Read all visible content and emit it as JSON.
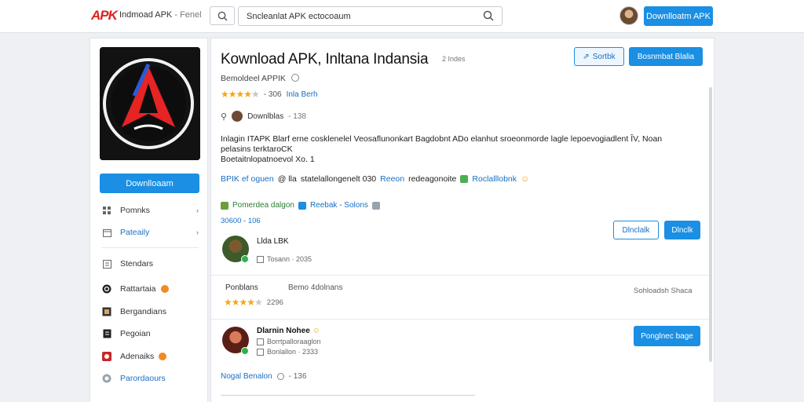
{
  "header": {
    "logo": "APK",
    "app_title": "Indmoad APK",
    "app_subtitle": "- Fenel",
    "search_value": "Sncleanlat APK ectocoaum",
    "download_label": "Downlloatm APK"
  },
  "sidebar": {
    "download_label": "Downlloaam",
    "items": [
      {
        "label": "Pomnks",
        "icon": "grid-icon"
      },
      {
        "label": "Pateaily",
        "icon": "calendar-icon"
      },
      {
        "label": "Stendars",
        "icon": "list-icon"
      },
      {
        "label": "Rattartaia",
        "icon": "at-icon"
      },
      {
        "label": "Bergandians",
        "icon": "book-icon"
      },
      {
        "label": "Pegoian",
        "icon": "doc-icon"
      },
      {
        "label": "Adenaiks",
        "icon": "red-app-icon"
      },
      {
        "label": "Parordaours",
        "icon": "circle-icon"
      }
    ]
  },
  "main": {
    "title": "Kownload APK, Inltana Indansia",
    "title_meta": "2 Indes",
    "share_label": "Sortbk",
    "report_label": "Bosnmbat Blalia",
    "developer": "Bemoldeel APPIK",
    "rating_value": "- 306",
    "rating_link": "Inla Berh",
    "downloads_label": "Downlblas",
    "downloads_meta": "- 138",
    "description_line1": "Inlagin ITAPK Blarf erne cosklenelel Veosaflunonkart Bagdobnt ADo elanhut sroeonmorde lagle lepoevogiadlent ÎV, Noan",
    "description_line2": "pelasins terktaroCK",
    "description_line3": "Boetaitnlopatnoevol Xo. 1",
    "tags": {
      "t1": "BPIK ef oguen",
      "t2": "@ lla",
      "t3": "statelallongenelt 030",
      "t4": "Reeon",
      "t5": "redeagonoite",
      "t6": "Roclalllobnk"
    },
    "features": {
      "f1": "Pomerdea dalgon",
      "f2": "Reebak - Solons"
    },
    "count": "30600 - 106",
    "user1": {
      "name": "Llda LBK",
      "meta": "Tosann · 2035"
    },
    "btn_outline1": "Dlnclalk",
    "btn_solid1": "Dlnclk",
    "reviews": {
      "label_left": "Ponblans",
      "label_mid": "Bemo 4dolnans",
      "label_right": "Sohloadsh Shaca",
      "score": "2296"
    },
    "user2": {
      "name": "Dlarnin Nohee",
      "meta1": "Borrtpalloraaglon",
      "meta2": "Bonlallon · 2333"
    },
    "btn_solid2": "Ponglnec bage",
    "footer_link": "Nogal Benalon",
    "footer_meta": "- 136"
  }
}
